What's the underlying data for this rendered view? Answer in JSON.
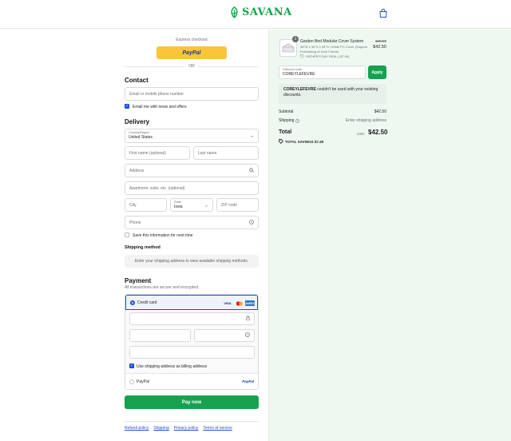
{
  "header": {
    "brand": "SAVANA"
  },
  "express": {
    "label": "Express checkout",
    "paypal_label": "PayPal",
    "or_label": "OR"
  },
  "contact": {
    "title": "Contact",
    "email_placeholder": "Email or mobile phone number",
    "news_label": "Email me with news and offers"
  },
  "delivery": {
    "title": "Delivery",
    "country_label": "Country/Region",
    "country_value": "United States",
    "first_name": "First name (optional)",
    "last_name": "Last name",
    "address": "Address",
    "apartment": "Apartment, suite, etc. (optional)",
    "city": "City",
    "state_label": "State",
    "state_value": "Iowa",
    "zip": "ZIP code",
    "phone": "Phone",
    "save_label": "Save this information for next time"
  },
  "shipping": {
    "title": "Shipping method",
    "note": "Enter your shipping address to view available shipping methods."
  },
  "payment": {
    "title": "Payment",
    "subtitle": "All transactions are secure and encrypted.",
    "credit_card_label": "Credit card",
    "cards": [
      "VISA",
      "MC",
      "AMEX"
    ],
    "billing_label": "Use shipping address as billing address",
    "paypal_label": "PayPal",
    "paypal_logo": "PayPal"
  },
  "pay_now_label": "Pay now",
  "footer_links": [
    "Refund policy",
    "Shipping",
    "Privacy policy",
    "Terms of service"
  ],
  "order": {
    "quantity": "1",
    "product_name": "Garden Bed Modular Cover System",
    "variant": "48\"W x 36\"D x 48\"H / White PC Cover (Support Purchasing w/ Arch Frame)",
    "deal": "FATHER'S DAY DEAL (-$7.49)",
    "price_old": "$49.99",
    "price_new": "$42.50",
    "discount_label": "Discount code",
    "discount_value": "COREYLEFEVRE",
    "apply_label": "Apply",
    "discount_code": "COREYLEFEVRE",
    "discount_msg": " couldn't be used with your existing discounts.",
    "subtotal_label": "Subtotal",
    "subtotal_value": "$42.50",
    "shipping_label": "Shipping",
    "shipping_value": "Enter shipping address",
    "total_label": "Total",
    "currency": "USD",
    "total_value": "$42.50",
    "savings": "TOTAL SAVINGS  $7.49"
  },
  "colors": {
    "brand": "#16a34a",
    "accent": "#1d4ed8",
    "pay": "#15a150",
    "paypal": "#f9c53b"
  }
}
